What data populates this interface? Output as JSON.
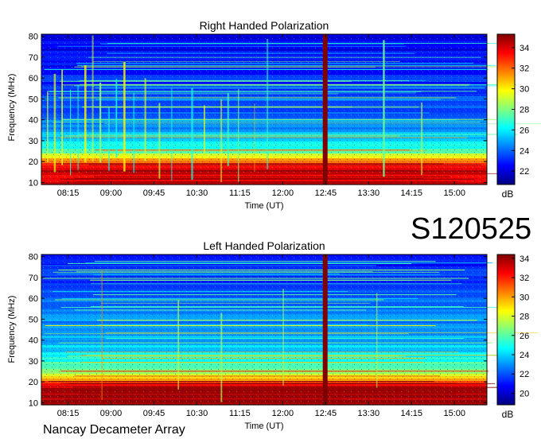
{
  "observation_code": "S120525",
  "instrument": "Nancay Decameter Array",
  "colormap": [
    "#00007f",
    "#0000ff",
    "#007fff",
    "#00ffff",
    "#7fff7f",
    "#ffff00",
    "#ff7f00",
    "#ff0000",
    "#7f0000"
  ],
  "chart_data": [
    {
      "type": "heatmap",
      "title": "Right Handed Polarization",
      "xlabel": "Time (UT)",
      "ylabel": "Frequency (MHz)",
      "x_ticks": [
        "08:15",
        "09:00",
        "09:45",
        "10:30",
        "11:15",
        "12:00",
        "12:45",
        "13:30",
        "14:15",
        "15:00"
      ],
      "x_tick_minutes": [
        495,
        540,
        585,
        630,
        675,
        720,
        765,
        810,
        855,
        900
      ],
      "x_range_minutes": [
        467,
        934
      ],
      "y_ticks": [
        10,
        20,
        30,
        40,
        50,
        60,
        70,
        80
      ],
      "ylim": [
        9,
        81
      ],
      "colorbar_label": "dB",
      "colorbar_ticks": [
        22,
        24,
        26,
        28,
        30,
        32,
        34
      ],
      "colorbar_range": [
        20.7,
        35.3
      ],
      "data_gap_minutes": [
        762,
        767
      ],
      "interference_times_minutes": [
        473,
        480,
        488,
        497,
        505,
        512,
        520,
        528,
        537,
        545,
        553,
        563,
        575,
        590,
        603,
        624,
        637,
        655,
        662,
        673,
        690,
        703,
        825,
        865
      ],
      "profile_db": [
        [
          10,
          34
        ],
        [
          16,
          34
        ],
        [
          19,
          33
        ],
        [
          22,
          30
        ],
        [
          25,
          27.5
        ],
        [
          30,
          25.5
        ],
        [
          40,
          24
        ],
        [
          60,
          23
        ],
        [
          81,
          22
        ]
      ]
    },
    {
      "type": "heatmap",
      "title": "Left Handed Polarization",
      "xlabel": "Time (UT)",
      "ylabel": "Frequency (MHz)",
      "x_ticks": [
        "08:15",
        "09:00",
        "09:45",
        "10:30",
        "11:15",
        "12:00",
        "12:45",
        "13:30",
        "14:15",
        "15:00"
      ],
      "x_tick_minutes": [
        495,
        540,
        585,
        630,
        675,
        720,
        765,
        810,
        855,
        900
      ],
      "x_range_minutes": [
        467,
        934
      ],
      "y_ticks": [
        10,
        20,
        30,
        40,
        50,
        60,
        70,
        80
      ],
      "ylim": [
        9,
        81
      ],
      "colorbar_label": "dB",
      "colorbar_ticks": [
        20,
        22,
        24,
        26,
        28,
        30,
        32,
        34
      ],
      "colorbar_range": [
        18.8,
        34.4
      ],
      "data_gap_minutes": [
        762,
        767
      ],
      "interference_times_minutes": [
        530,
        610,
        655,
        720,
        818
      ],
      "profile_db": [
        [
          10,
          34
        ],
        [
          16,
          33.5
        ],
        [
          19,
          32
        ],
        [
          22,
          29
        ],
        [
          25,
          27
        ],
        [
          30,
          25
        ],
        [
          40,
          23.5
        ],
        [
          60,
          22
        ],
        [
          81,
          21
        ]
      ]
    }
  ]
}
